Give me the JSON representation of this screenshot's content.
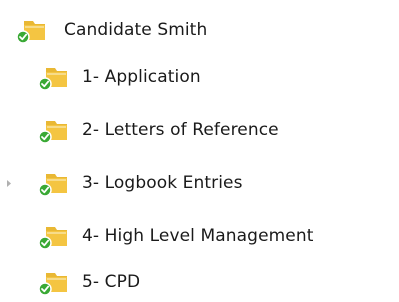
{
  "tree": {
    "root": {
      "label": "Candidate Smith",
      "icon": "shared-folder-icon"
    },
    "children": [
      {
        "label": "1- Application",
        "icon": "shared-folder-icon",
        "has_children": false
      },
      {
        "label": "2- Letters of Reference",
        "icon": "shared-folder-icon",
        "has_children": false
      },
      {
        "label": "3- Logbook Entries",
        "icon": "shared-folder-icon",
        "has_children": true
      },
      {
        "label": "4- High Level Management",
        "icon": "shared-folder-icon",
        "has_children": false
      },
      {
        "label": "5- CPD",
        "icon": "shared-folder-icon",
        "has_children": false
      }
    ]
  },
  "colors": {
    "folder_body": "#f4c542",
    "folder_tab": "#e9b834",
    "folder_inner": "#f7dc8a",
    "sync_badge_green": "#3aa935",
    "expander_arrow": "#9a9a9a",
    "text": "#1a1a1a"
  }
}
